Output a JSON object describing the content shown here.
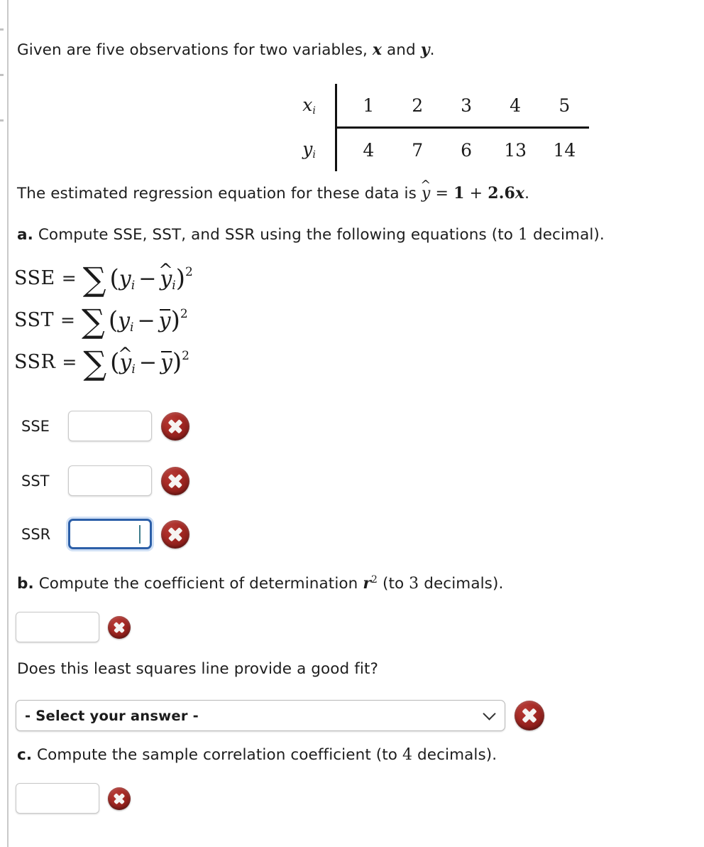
{
  "problem": {
    "intro_prefix": "Given are five observations for two variables, ",
    "intro_var1": "x",
    "intro_conj": " and ",
    "intro_var2": "y",
    "intro_suffix": ".",
    "regression_prefix": "The estimated regression equation for these data is ",
    "regression_yhat": "y",
    "regression_equals": " = ",
    "regression_intercept": "1",
    "regression_plus": " + ",
    "regression_slope": "2.6",
    "regression_x": "x",
    "regression_suffix": "."
  },
  "table": {
    "row_x_label": "x",
    "row_x_sub": "i",
    "row_y_label": "y",
    "row_y_sub": "i",
    "x_values": [
      "1",
      "2",
      "3",
      "4",
      "5"
    ],
    "y_values": [
      "4",
      "7",
      "6",
      "13",
      "14"
    ]
  },
  "chart_data": {
    "type": "table",
    "title": "Five observations for two variables x and y",
    "columns": [
      "x_i",
      "y_i"
    ],
    "x": [
      1,
      2,
      3,
      4,
      5
    ],
    "y": [
      4,
      7,
      6,
      13,
      14
    ],
    "series": [
      {
        "name": "x_i",
        "values": [
          1,
          2,
          3,
          4,
          5
        ]
      },
      {
        "name": "y_i",
        "values": [
          4,
          7,
          6,
          13,
          14
        ]
      }
    ],
    "annotations": [
      "Estimated regression equation: yhat = 1 + 2.6x"
    ],
    "xlabel": "x_i",
    "ylabel": "y_i"
  },
  "part_a": {
    "marker": "a.",
    "text_before": " Compute SSE, SST, and SSR using the following equations (to ",
    "decimals": "1",
    "text_after": " decimal).",
    "formulas": [
      {
        "lhs": "SSE",
        "body_first": "y",
        "body_first_sub": "i",
        "body_second": "y",
        "body_second_sub": "i",
        "body_second_hat": true,
        "exponent": "2"
      },
      {
        "lhs": "SST",
        "body_first": "y",
        "body_first_sub": "i",
        "body_second": "y",
        "body_second_bar": true,
        "exponent": "2"
      },
      {
        "lhs": "SSR",
        "body_first": "y",
        "body_first_sub": "i",
        "body_first_hat": true,
        "body_second": "y",
        "body_second_bar": true,
        "exponent": "2"
      }
    ],
    "fields": [
      {
        "label": "SSE",
        "value": "",
        "focused": false
      },
      {
        "label": "SST",
        "value": "",
        "focused": false
      },
      {
        "label": "SSR",
        "value": "",
        "focused": true
      }
    ],
    "error_icon": "x-circle-icon"
  },
  "part_b": {
    "marker": "b.",
    "text_before": " Compute the coefficient of determination ",
    "symbol": "r",
    "symbol_exp": "2",
    "text_mid": " (to ",
    "decimals": "3",
    "text_after": " decimals).",
    "value": "",
    "error_icon": "x-circle-icon",
    "question": "Does this least squares line provide a good fit?",
    "select_value": "- Select your answer -"
  },
  "part_c": {
    "marker": "c.",
    "text_before": " Compute the sample correlation coefficient (to ",
    "decimals": "4",
    "text_after": " decimals).",
    "value": "",
    "error_icon": "x-circle-icon"
  },
  "colors": {
    "error_red": "#a82b26",
    "focus_blue": "#2c5fa8",
    "rule_gray": "#c9c9c9",
    "text": "#1d1d1d"
  }
}
